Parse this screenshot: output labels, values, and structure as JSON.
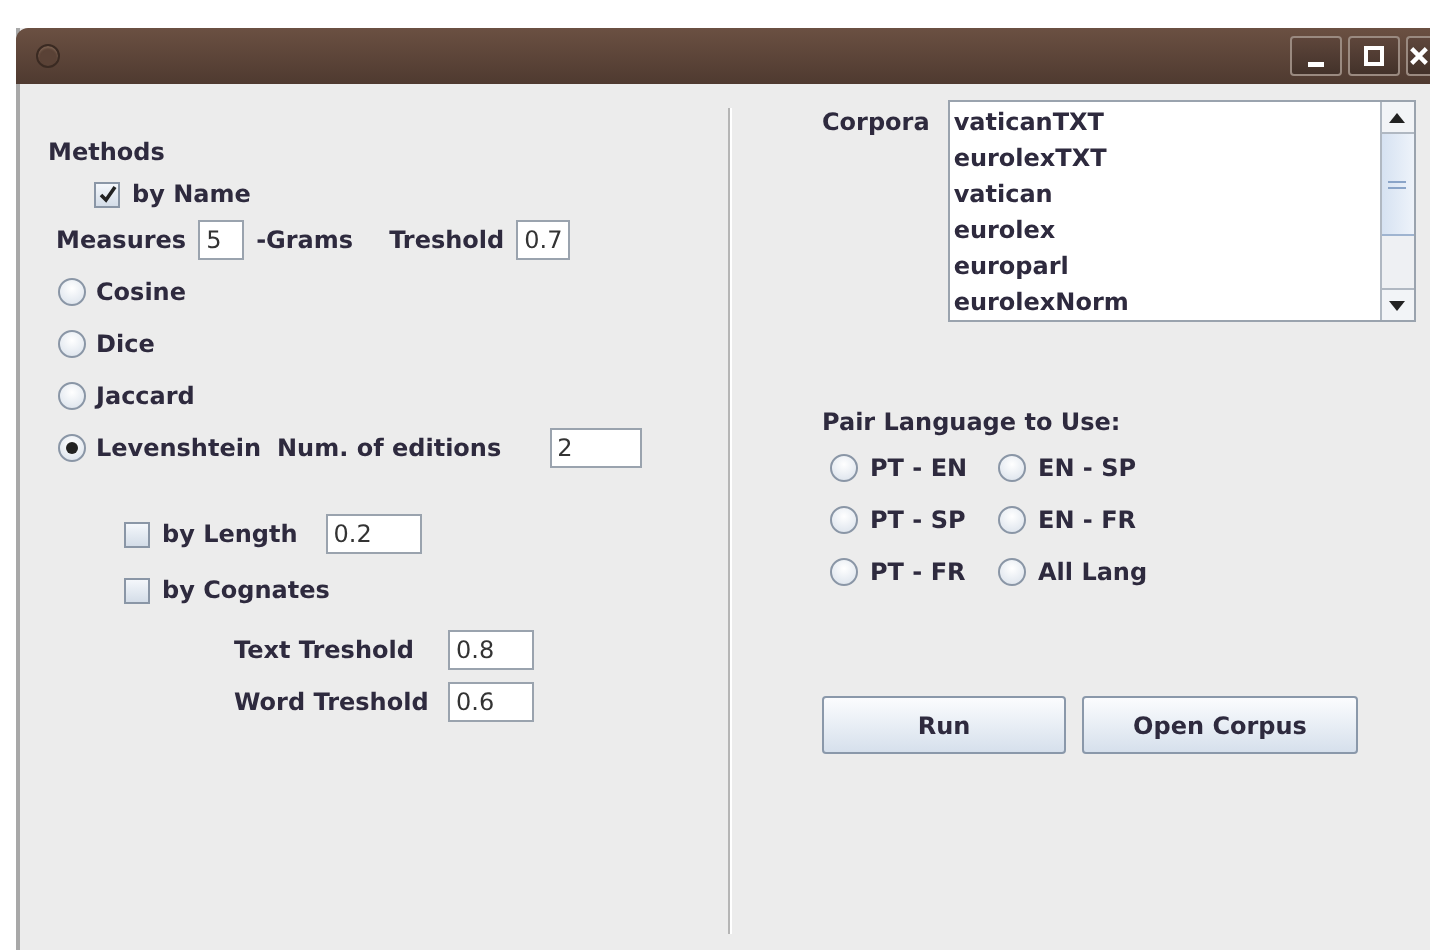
{
  "methods": {
    "label": "Methods",
    "by_name": {
      "label": "by Name",
      "checked": true
    }
  },
  "measures": {
    "label": "Measures",
    "grams_value": "5",
    "grams_label": "-Grams",
    "threshold_label": "Treshold",
    "threshold_value": "0.7"
  },
  "measure_options": [
    {
      "label": "Cosine",
      "selected": false
    },
    {
      "label": "Dice",
      "selected": false
    },
    {
      "label": "Jaccard",
      "selected": false
    },
    {
      "label": "Levenshtein",
      "selected": true,
      "extra_label": "Num. of editions",
      "extra_value": "2"
    }
  ],
  "filters": [
    {
      "label": "by Length",
      "checked": false,
      "value": "0.2"
    },
    {
      "label": "by Cognates",
      "checked": false
    }
  ],
  "cognate_thresholds": [
    {
      "label": "Text Treshold",
      "value": "0.8"
    },
    {
      "label": "Word Treshold",
      "value": "0.6"
    }
  ],
  "corpora": {
    "label": "Corpora",
    "items": [
      {
        "label": "vaticanTXT",
        "selected": false
      },
      {
        "label": "eurolexTXT",
        "selected": false
      },
      {
        "label": "vatican",
        "selected": false
      },
      {
        "label": "eurolex",
        "selected": false
      },
      {
        "label": "europarl",
        "selected": false
      },
      {
        "label": "eurolexNorm",
        "selected": false
      }
    ]
  },
  "pair_language": {
    "label": "Pair Language to Use:",
    "options": [
      {
        "label": "PT - EN",
        "selected": false
      },
      {
        "label": "EN - SP",
        "selected": false
      },
      {
        "label": "PT - SP",
        "selected": false
      },
      {
        "label": "EN - FR",
        "selected": false
      },
      {
        "label": "PT - FR",
        "selected": false
      },
      {
        "label": "All Lang",
        "selected": false
      }
    ]
  },
  "buttons": [
    "Run",
    "Open Corpus"
  ]
}
